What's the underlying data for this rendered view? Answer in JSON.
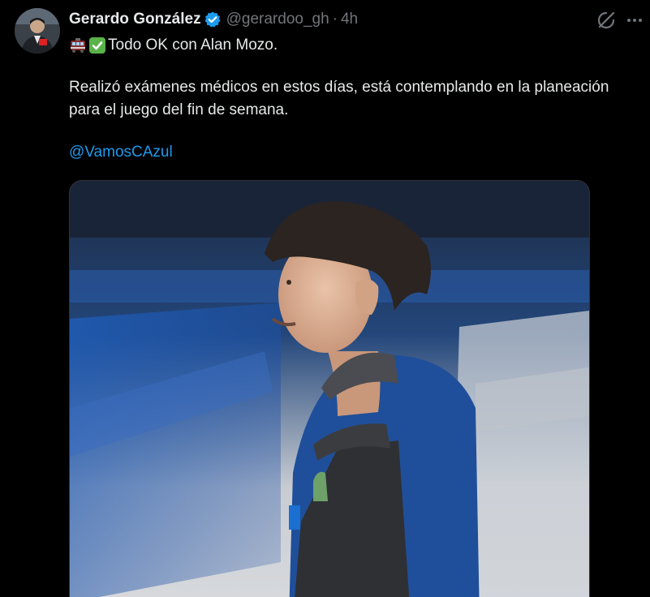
{
  "tweet": {
    "author_name": "Gerardo González",
    "handle": "@gerardoo_gh",
    "separator": "·",
    "time": "4h",
    "line1_text": "Todo OK con Alan Mozo.",
    "line1_emojis": [
      "train-emoji",
      "check-mark-emoji"
    ],
    "paragraph": "Realizó exámenes médicos en estos días, está contemplando en la planeación para el juego del fin de semana.",
    "mention": "@VamosCAzul"
  },
  "icons": {
    "verified": "verified-badge-icon",
    "grok": "grok-icon",
    "more": "more-options-icon"
  },
  "colors": {
    "background": "#000000",
    "text": "#e7e9ea",
    "muted": "#71767b",
    "link": "#1d9bf0",
    "verified": "#1d9bf0"
  }
}
